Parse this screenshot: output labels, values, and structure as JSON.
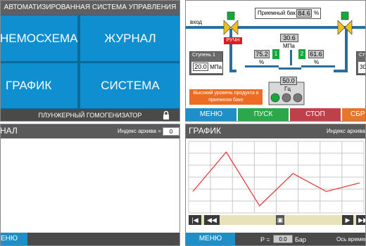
{
  "main_menu": {
    "title": "АВТОМАТИЗИРОВАННАЯ СИСТЕМА УПРАВЛЕНИЯ",
    "tiles": [
      "НЕМОСХЕМА",
      "ЖУРНАЛ",
      "ГРАФИК",
      "СИСТЕМА"
    ],
    "footer": "ПЛУНЖЕРНЫЙ ГОМОГЕНИЗАТОР"
  },
  "mnemo": {
    "inlet_label": "вход",
    "tank_label": "Приемный бак",
    "tank_value": "84.6",
    "tank_unit": "%",
    "manual_badge": "РУЧН",
    "pressure_value": "30.6",
    "pressure_unit": "МПа",
    "stage1_title": "Ступень 1",
    "stage1_value": "20.0",
    "stage1_unit": "МПа",
    "stage2_title": "Ступ",
    "stage2_value": "30.",
    "left_pct": "75.2",
    "left_pct_unit": "%",
    "left_ind": "1",
    "right_ind": "2",
    "right_pct": "61.6",
    "right_pct_unit": "%",
    "freq_value": "50.0",
    "freq_unit": "Гц",
    "alarm": "Высокий уровень продукта в приемном баке",
    "buttons": [
      "МЕНЮ",
      "ПУСК",
      "СТОП",
      "СБР"
    ],
    "colors": {
      "menu": "#1f8fc7",
      "start": "#2aa84a",
      "stop": "#c0404a",
      "reset": "#e5762b"
    }
  },
  "journal": {
    "title": "НАЛ",
    "archive_label": "Индекс архива =",
    "archive_value": "0",
    "menu": "ЕНЮ"
  },
  "graph": {
    "title": "ГРАФИК",
    "archive_label": "Индекс архива",
    "pressure_label": "P =",
    "pressure_value": "0.0",
    "pressure_unit": "Бар",
    "time_axis": "Ось времен",
    "menu": "МЕНЮ",
    "trend_color": "#e33030"
  },
  "chart_data": {
    "type": "line",
    "x": [
      0,
      1,
      2,
      3,
      4,
      5
    ],
    "series": [
      {
        "values": [
          0.3,
          0.85,
          0.1,
          0.55,
          0.3,
          0.42
        ]
      }
    ],
    "ylim": [
      0,
      1
    ],
    "grid": true
  }
}
